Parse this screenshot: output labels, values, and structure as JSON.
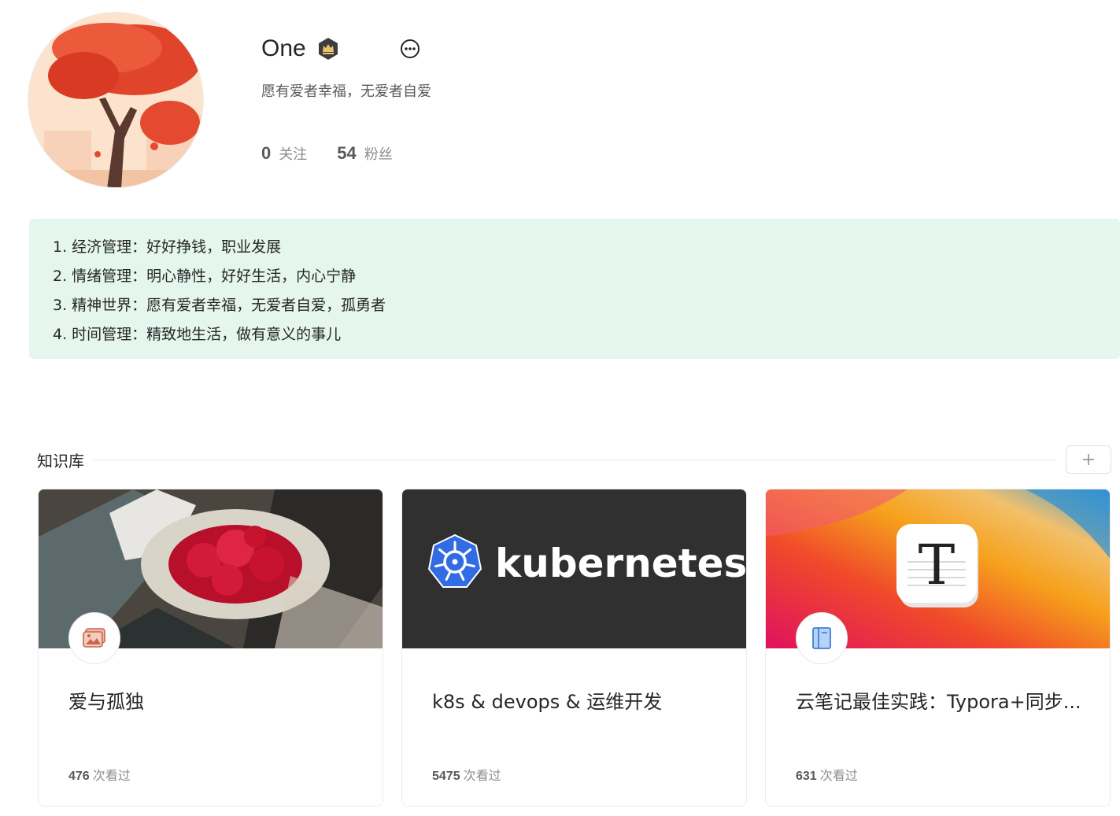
{
  "profile": {
    "name": "One",
    "bio": "愿有爱者幸福，无爱者自爱",
    "following_count": "0",
    "following_label": "关注",
    "followers_count": "54",
    "followers_label": "粉丝"
  },
  "description": {
    "items": [
      "1. 经济管理：好好挣钱，职业发展",
      "2. 情绪管理：明心静性，好好生活，内心宁静",
      "3. 精神世界：愿有爱者幸福，无爱者自爱，孤勇者",
      "4. 时间管理：精致地生活，做有意义的事儿"
    ],
    "background": "#e4f6ed"
  },
  "library": {
    "title": "知识库",
    "add_icon": "plus-icon",
    "cards": [
      {
        "title": "爱与孤独",
        "views": "476",
        "views_label": "次看过",
        "icon": "image-icon"
      },
      {
        "title": "k8s & devops & 运维开发",
        "views": "5475",
        "views_label": "次看过",
        "icon": "none",
        "cover_text": "kubernetes"
      },
      {
        "title": "云笔记最佳实践：Typora+同步...",
        "views": "631",
        "views_label": "次看过",
        "icon": "book-icon",
        "cover_text": "T"
      }
    ]
  },
  "colors": {
    "text": "#262626",
    "muted": "#8a8f8d",
    "k8s_blue": "#326ce5"
  }
}
